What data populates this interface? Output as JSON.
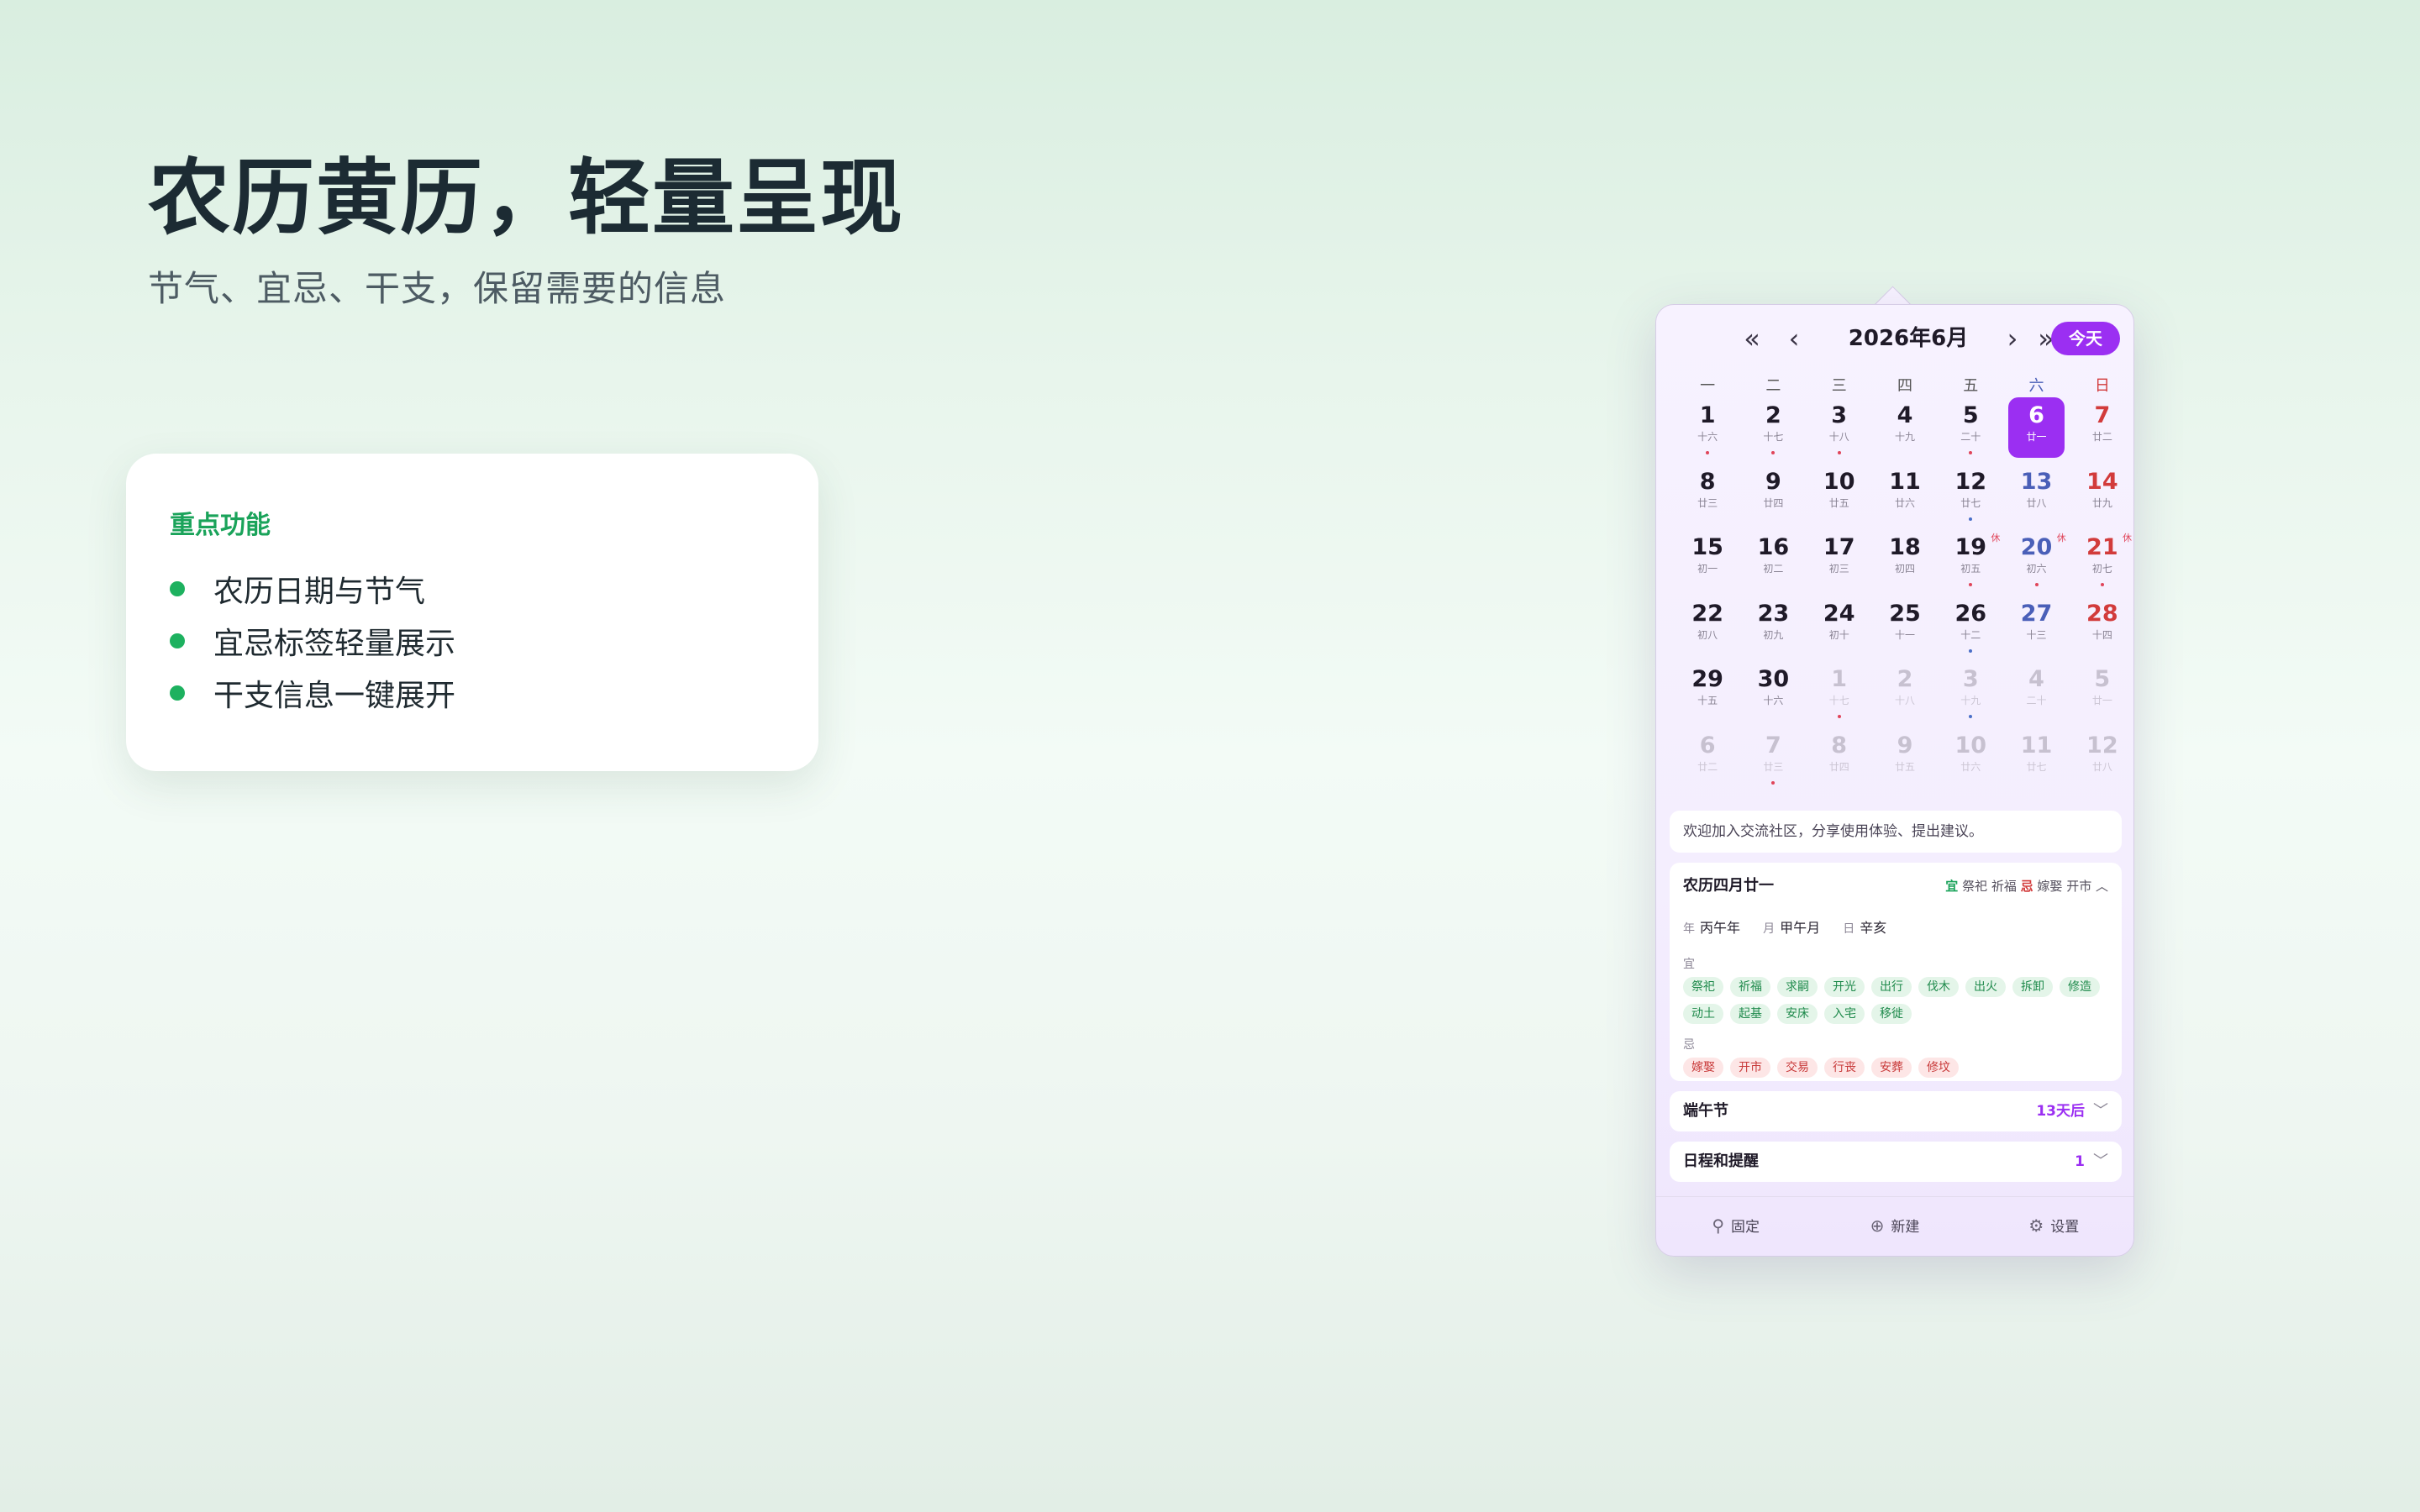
{
  "hero": {
    "title": "农历黄历，轻量呈现",
    "subtitle": "节气、宜忌、干支，保留需要的信息"
  },
  "features": {
    "title": "重点功能",
    "items": [
      "农历日期与节气",
      "宜忌标签轻量展示",
      "干支信息一键展开"
    ]
  },
  "calendar": {
    "month_title": "2026年6月",
    "today_label": "今天",
    "nav": {
      "prev_year": "«",
      "prev_month": "‹",
      "next_month": "›",
      "next_year": "»"
    },
    "weekdays": [
      "一",
      "二",
      "三",
      "四",
      "五",
      "六",
      "日"
    ],
    "rest_label": "休",
    "weeks": [
      [
        {
          "d": "1",
          "l": "十六",
          "m": "red"
        },
        {
          "d": "2",
          "l": "十七",
          "m": "red"
        },
        {
          "d": "3",
          "l": "十八",
          "m": "red"
        },
        {
          "d": "4",
          "l": "十九"
        },
        {
          "d": "5",
          "l": "二十",
          "m": "red"
        },
        {
          "d": "6",
          "l": "廿一",
          "sel": true
        },
        {
          "d": "7",
          "l": "廿二"
        }
      ],
      [
        {
          "d": "8",
          "l": "廿三"
        },
        {
          "d": "9",
          "l": "廿四"
        },
        {
          "d": "10",
          "l": "廿五"
        },
        {
          "d": "11",
          "l": "廿六"
        },
        {
          "d": "12",
          "l": "廿七",
          "m": "blue"
        },
        {
          "d": "13",
          "l": "廿八"
        },
        {
          "d": "14",
          "l": "廿九"
        }
      ],
      [
        {
          "d": "15",
          "l": "初一"
        },
        {
          "d": "16",
          "l": "初二"
        },
        {
          "d": "17",
          "l": "初三"
        },
        {
          "d": "18",
          "l": "初四"
        },
        {
          "d": "19",
          "l": "初五",
          "m": "red",
          "rest": true
        },
        {
          "d": "20",
          "l": "初六",
          "m": "red",
          "rest": true
        },
        {
          "d": "21",
          "l": "初七",
          "m": "red",
          "rest": true
        }
      ],
      [
        {
          "d": "22",
          "l": "初八"
        },
        {
          "d": "23",
          "l": "初九"
        },
        {
          "d": "24",
          "l": "初十"
        },
        {
          "d": "25",
          "l": "十一"
        },
        {
          "d": "26",
          "l": "十二",
          "m": "blue"
        },
        {
          "d": "27",
          "l": "十三"
        },
        {
          "d": "28",
          "l": "十四"
        }
      ],
      [
        {
          "d": "29",
          "l": "十五"
        },
        {
          "d": "30",
          "l": "十六"
        },
        {
          "d": "1",
          "l": "十七",
          "o": true,
          "m": "red"
        },
        {
          "d": "2",
          "l": "十八",
          "o": true
        },
        {
          "d": "3",
          "l": "十九",
          "o": true,
          "m": "blue"
        },
        {
          "d": "4",
          "l": "二十",
          "o": true
        },
        {
          "d": "5",
          "l": "廿一",
          "o": true
        }
      ],
      [
        {
          "d": "6",
          "l": "廿二",
          "o": true
        },
        {
          "d": "7",
          "l": "廿三",
          "o": true,
          "m": "red"
        },
        {
          "d": "8",
          "l": "廿四",
          "o": true
        },
        {
          "d": "9",
          "l": "廿五",
          "o": true
        },
        {
          "d": "10",
          "l": "廿六",
          "o": true
        },
        {
          "d": "11",
          "l": "廿七",
          "o": true
        },
        {
          "d": "12",
          "l": "廿八",
          "o": true
        }
      ]
    ]
  },
  "notice": "欢迎加入交流社区，分享使用体验、提出建议。",
  "almanac": {
    "title": "农历四月廿一",
    "yi_badge": "宜",
    "yi_summary": "祭祀 祈福",
    "ji_badge": "忌",
    "ji_summary": "嫁娶 开市",
    "chevron": "︿",
    "ganzhi": [
      {
        "label": "年",
        "value": "丙午年"
      },
      {
        "label": "月",
        "value": "甲午月"
      },
      {
        "label": "日",
        "value": "辛亥"
      }
    ],
    "yi_label": "宜",
    "yi_tags": [
      "祭祀",
      "祈福",
      "求嗣",
      "开光",
      "出行",
      "伐木",
      "出火",
      "拆卸",
      "修造",
      "动土",
      "起基",
      "安床",
      "入宅",
      "移徙"
    ],
    "ji_label": "忌",
    "ji_tags": [
      "嫁娶",
      "开市",
      "交易",
      "行丧",
      "安葬",
      "修坟"
    ]
  },
  "festival": {
    "label": "端午节",
    "value": "13天后",
    "chevron": "﹀"
  },
  "schedule": {
    "label": "日程和提醒",
    "value": "1",
    "chevron": "﹀"
  },
  "footer": {
    "pin": {
      "icon": "pin-icon",
      "label": "固定"
    },
    "add": {
      "icon": "plus-circle-icon",
      "label": "新建"
    },
    "settings": {
      "icon": "gear-icon",
      "label": "设置"
    }
  }
}
